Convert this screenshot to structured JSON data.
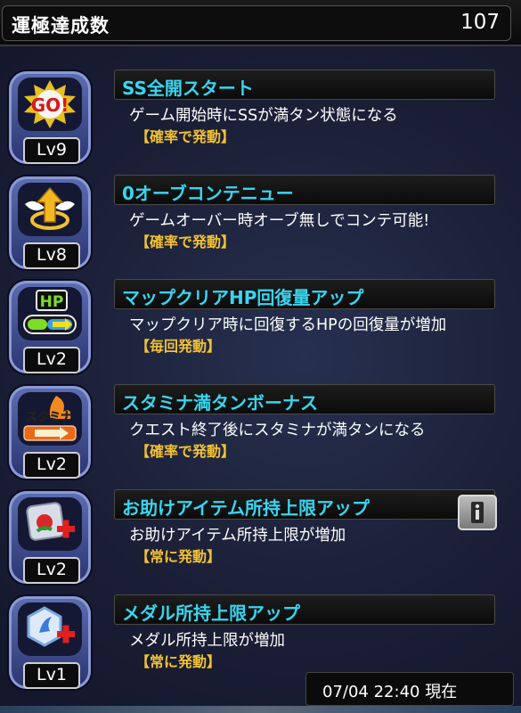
{
  "header": {
    "title": "運極達成数",
    "count": "107"
  },
  "items": [
    {
      "level": "Lv9",
      "title": "SS全開スタート",
      "description": "ゲーム開始時にSSが満タン状態になる",
      "trigger": "【確率で発動】",
      "icon": "go-icon",
      "icon_text": "GO!"
    },
    {
      "level": "Lv8",
      "title": "0オーブコンテニュー",
      "description": "ゲームオーバー時オーブ無しでコンテ可能!",
      "trigger": "【確率で発動】",
      "icon": "winged-arrow-icon"
    },
    {
      "level": "Lv2",
      "title": "マップクリアHP回復量アップ",
      "description": "マップクリア時に回復するHPの回復量が増加",
      "trigger": "【毎回発動】",
      "icon": "hp-gauge-icon",
      "icon_text": "HP"
    },
    {
      "level": "Lv2",
      "title": "スタミナ満タンボーナス",
      "description": "クエスト終了後にスタミナが満タンになる",
      "trigger": "【確率で発動】",
      "icon": "stamina-icon",
      "icon_text": "スタミナ"
    },
    {
      "level": "Lv2",
      "title": "お助けアイテム所持上限アップ",
      "description": "お助けアイテム所持上限が増加",
      "trigger": "【常に発動】",
      "icon": "item-plus-icon"
    },
    {
      "level": "Lv1",
      "title": "メダル所持上限アップ",
      "description": "メダル所持上限が増加",
      "trigger": "【常に発動】",
      "icon": "medal-plus-icon"
    }
  ],
  "footer": {
    "timestamp": "07/04 22:40 現在"
  },
  "colors": {
    "title_text": "#37d6f0",
    "trigger_text": "#f2c232",
    "background": "#1b1f36"
  }
}
